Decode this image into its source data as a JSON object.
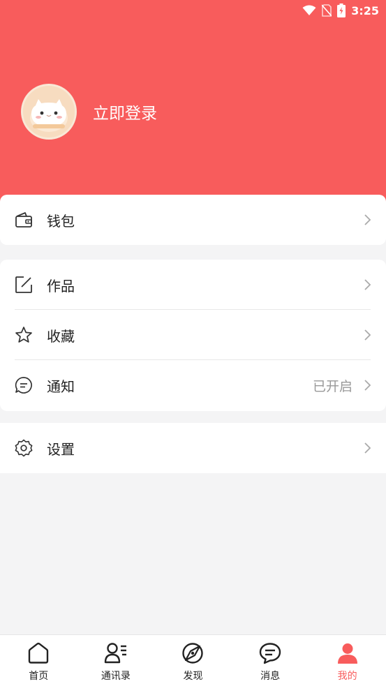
{
  "status_bar": {
    "time": "3:25",
    "icons": [
      "wifi-icon",
      "no-sim-icon",
      "battery-charging-icon"
    ]
  },
  "profile": {
    "login_label": "立即登录",
    "avatar": "cat-avatar"
  },
  "menu": {
    "wallet": {
      "label": "钱包",
      "icon": "wallet-icon"
    },
    "works": {
      "label": "作品",
      "icon": "edit-icon"
    },
    "favorites": {
      "label": "收藏",
      "icon": "star-icon"
    },
    "notifications": {
      "label": "通知",
      "value": "已开启",
      "icon": "chat-bubble-icon"
    },
    "settings": {
      "label": "设置",
      "icon": "gear-icon"
    }
  },
  "tabbar": {
    "items": [
      {
        "label": "首页",
        "icon": "home-icon",
        "active": false
      },
      {
        "label": "通讯录",
        "icon": "contacts-icon",
        "active": false
      },
      {
        "label": "发现",
        "icon": "compass-icon",
        "active": false
      },
      {
        "label": "消息",
        "icon": "message-icon",
        "active": false
      },
      {
        "label": "我的",
        "icon": "user-icon",
        "active": true
      }
    ]
  },
  "colors": {
    "accent": "#f85c5c",
    "background": "#f4f4f5",
    "card": "#ffffff",
    "muted_text": "#999999"
  }
}
